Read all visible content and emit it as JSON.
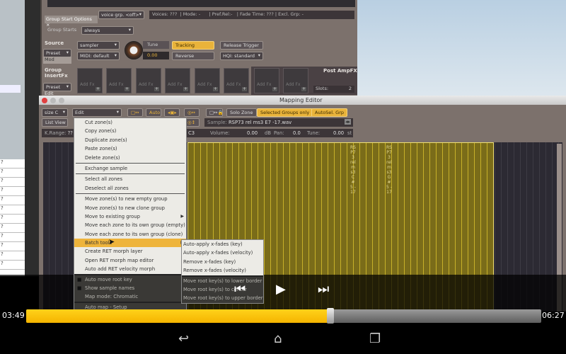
{
  "kontakt": {
    "voice_group": "voice grp. <off>",
    "voices_label": "Voices:",
    "voices": "???",
    "mode_label": "Mode:",
    "mode": "-",
    "pref_rel_label": "Pref.Rel:",
    "pref_rel": "-",
    "fade_time_label": "Fade Time:",
    "fade_time": "???",
    "excl_grp_label": "Excl. Grp:",
    "excl_grp": "-",
    "tab": "Group Start Options ×",
    "group_starts_label": "Group Starts",
    "group_starts": "always",
    "source_label": "Source",
    "preset": "Preset",
    "mod": "Mod",
    "source": "sampler",
    "midi": "MIDI: default",
    "tune_label": "Tune",
    "tune_value": "0.00",
    "tracking": "Tracking",
    "reverse": "Reverse",
    "release_trigger": "Release Trigger",
    "hq": "HQI: standard",
    "insert_fx_label": "Group InsertFx",
    "edit": "Edit",
    "add_fx": "Add Fx",
    "post_amp_fx": "Post AmpFX",
    "slots_label": "Slots:",
    "slots": "2"
  },
  "mapping_editor": {
    "title": "Mapping Editor",
    "size": "size C",
    "edit_menu": "Edit",
    "auto": "Auto",
    "solo_zone": "Solo Zone",
    "selected_groups_only": "Selected Groups only",
    "autosel_grp": "AutoSel. Grp",
    "list_view": "List View",
    "sample_label": "Sample:",
    "sample": "RSP73 rel ms3 E7 -17.wav",
    "k_range_label": "K.Range:",
    "k_range": "??",
    "root": "C3",
    "volume_label": "Volume:",
    "volume": "0.00",
    "volume_unit": "dB",
    "pan_label": "Pan:",
    "pan": "0.0",
    "tune_label": "Tune:",
    "tune": "0.00",
    "tune_unit": "st",
    "zone_names": [
      "RSP73 rel ms3 C#5 -17",
      "RSP73 rel ms3 G#5 -17"
    ],
    "accent": "#e9b33a",
    "zone_color": "#7a6c19"
  },
  "edit_menu": {
    "items": [
      "Cut zone(s)",
      "Copy zone(s)",
      "Duplicate zone(s)",
      "Paste zone(s)",
      "Delete zone(s)",
      "Exchange sample",
      "Select all zones",
      "Deselect all zones",
      "Move zone(s) to new empty group",
      "Move zone(s) to new clone group",
      "Move to existing group",
      "Move each zone to its own group (empty)",
      "Move each zone to its own group (clone)",
      "Batch tools",
      "Create RET morph layer",
      "Open RET morph map editor",
      "Auto add RET velocity morph",
      "Auto move root key",
      "Show sample names",
      "Map mode: Chromatic",
      "Auto map - Setup"
    ],
    "highlighted": "Batch tools"
  },
  "batch_submenu": {
    "items": [
      "Auto-apply x-fades (key)",
      "Auto-apply x-fades (velocity)",
      "Remove x-fades (key)",
      "Remove x-fades (velocity)",
      "Move root key(s) to lower border",
      "Move root key(s) to center",
      "Move root key(s) to upper border"
    ]
  },
  "player": {
    "elapsed": "03:49",
    "duration": "06:27",
    "progress_percent": 59,
    "progress_color": "#ffc400",
    "icons": [
      "skip-previous-icon",
      "play-icon",
      "skip-next-icon"
    ]
  },
  "left_list": [
    "?",
    "?",
    "?",
    "?",
    "?",
    "?",
    "?",
    "?",
    "?",
    "?",
    "?",
    "?"
  ],
  "navbar": {
    "icons": [
      "back-icon",
      "home-icon",
      "recents-icon"
    ]
  }
}
